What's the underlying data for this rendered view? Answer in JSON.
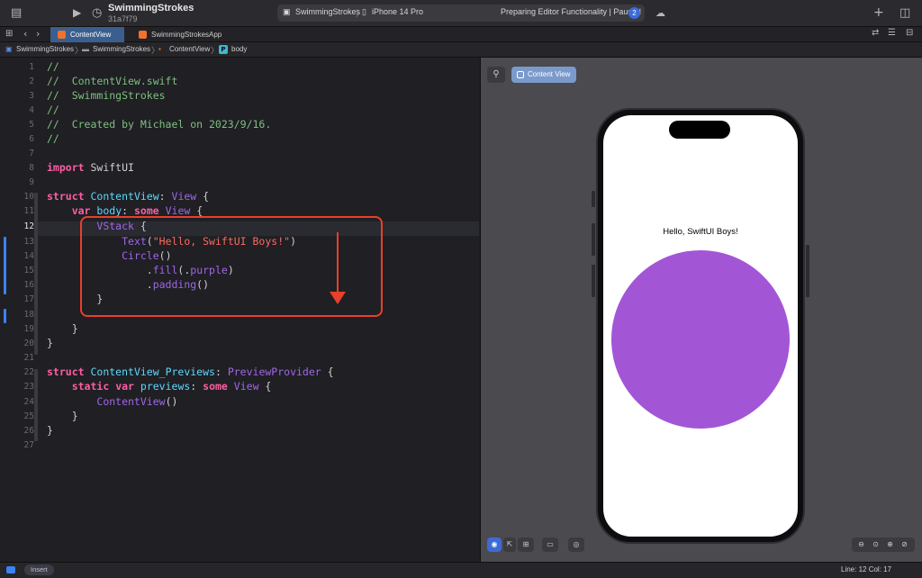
{
  "window": {
    "project_name": "SwimmingStrokes",
    "commit_hash": "31a7f79",
    "scheme_target": "SwimmingStrokes",
    "device": "iPhone 14 Pro",
    "status_text": "Preparing Editor Functionality | Paused",
    "issue_count": "2"
  },
  "tabs": [
    {
      "label": "ContentView",
      "active": true
    },
    {
      "label": "SwimmingStrokesApp",
      "active": false
    }
  ],
  "jumpbar": {
    "project": "SwimmingStrokes",
    "group": "SwimmingStrokes",
    "file": "ContentView",
    "symbol_badge": "P",
    "symbol": "body"
  },
  "editor": {
    "line_numbers": [
      "1",
      "2",
      "3",
      "4",
      "5",
      "6",
      "7",
      "8",
      "9",
      "10",
      "11",
      "12",
      "13",
      "14",
      "15",
      "16",
      "17",
      "18",
      "19",
      "20",
      "21",
      "22",
      "23",
      "24",
      "25",
      "26",
      "27"
    ],
    "current_line": 12
  },
  "preview": {
    "content_view_button": "Content View",
    "text_label": "Hello, SwiftUI Boys!",
    "circle_color": "#a256d6"
  },
  "statusbar": {
    "mode": "Insert",
    "position": "Line: 12  Col: 17"
  },
  "annotation_color": "#e8402a"
}
